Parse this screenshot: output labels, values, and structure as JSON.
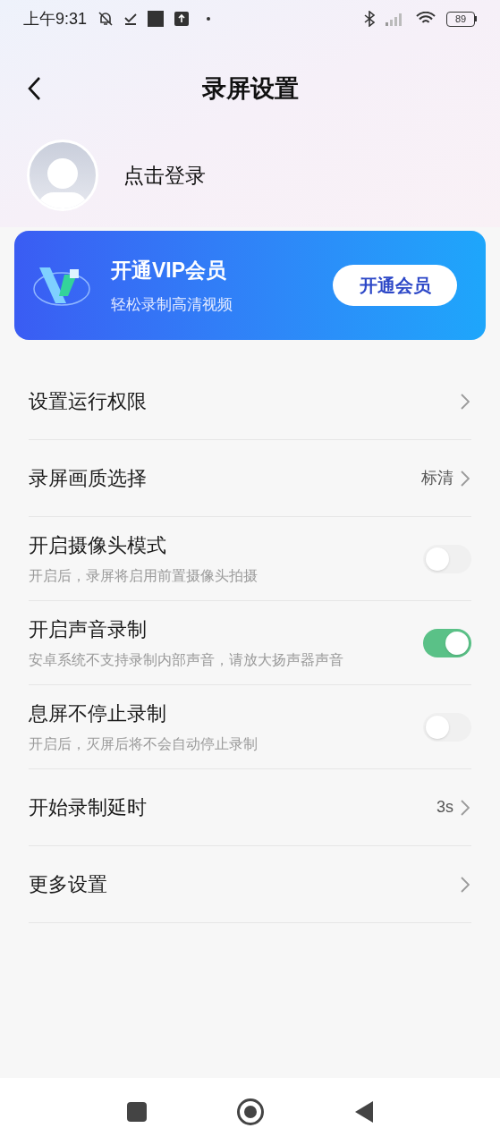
{
  "status_bar": {
    "time": "上午9:31",
    "battery": "89"
  },
  "header": {
    "title": "录屏设置"
  },
  "profile": {
    "login_label": "点击登录"
  },
  "vip_banner": {
    "title": "开通VIP会员",
    "subtitle": "轻松录制高清视频",
    "button": "开通会员"
  },
  "settings": [
    {
      "kind": "link",
      "label": "设置运行权限"
    },
    {
      "kind": "link",
      "label": "录屏画质选择",
      "value": "标清"
    },
    {
      "kind": "toggle",
      "label": "开启摄像头模式",
      "description": "开启后，录屏将启用前置摄像头拍摄",
      "on": false
    },
    {
      "kind": "toggle",
      "label": "开启声音录制",
      "description": "安卓系统不支持录制内部声音，请放大扬声器声音",
      "on": true
    },
    {
      "kind": "toggle",
      "label": "息屏不停止录制",
      "description": "开启后，灭屏后将不会自动停止录制",
      "on": false
    },
    {
      "kind": "link",
      "label": "开始录制延时",
      "value": "3s"
    },
    {
      "kind": "link",
      "label": "更多设置"
    }
  ]
}
